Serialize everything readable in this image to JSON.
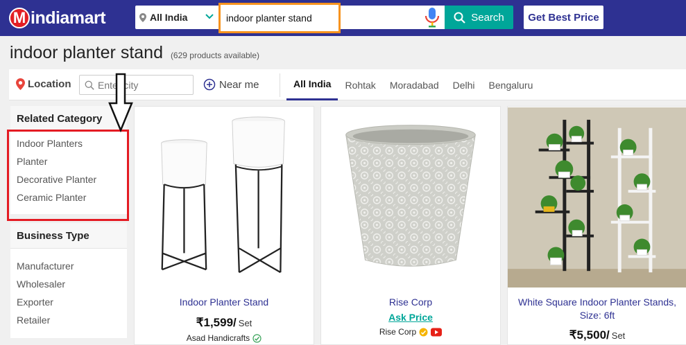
{
  "header": {
    "logo_letter": "M",
    "logo_text": "indiamart",
    "location_select": "All India",
    "search_value": "indoor planter stand",
    "search_button": "Search",
    "best_price_button": "Get Best Price"
  },
  "page": {
    "title": "indoor planter stand",
    "count": "(629 products available)"
  },
  "filters": {
    "location_label": "Location",
    "city_placeholder": "Enter city",
    "near_me": "Near me",
    "cities": [
      {
        "label": "All India",
        "active": true
      },
      {
        "label": "Rohtak",
        "active": false
      },
      {
        "label": "Moradabad",
        "active": false
      },
      {
        "label": "Delhi",
        "active": false
      },
      {
        "label": "Bengaluru",
        "active": false
      }
    ]
  },
  "sidebar": {
    "related_category": {
      "title": "Related Category",
      "items": [
        "Indoor Planters",
        "Planter",
        "Decorative Planter",
        "Ceramic Planter"
      ]
    },
    "business_type": {
      "title": "Business Type",
      "items": [
        "Manufacturer",
        "Wholesaler",
        "Exporter",
        "Retailer"
      ]
    }
  },
  "products": [
    {
      "name": "Indoor Planter Stand",
      "price": "₹1,599/",
      "unit": "Set",
      "seller": "Asad Handicrafts"
    },
    {
      "name": "Rise Corp",
      "ask_price": "Ask Price",
      "seller": "Rise Corp"
    },
    {
      "name": "White Square Indoor Planter Stands, Size: 6ft",
      "price": "₹5,500/",
      "unit": "Set"
    }
  ],
  "colors": {
    "brand": "#2e3192",
    "accent": "#00a699",
    "highlight_orange": "#f7931e",
    "annotation_red": "#e41b23"
  },
  "icons": [
    "location-pin-icon",
    "chevron-down-icon",
    "mic-icon",
    "search-icon",
    "near-me-icon",
    "verified-icon",
    "youtube-icon",
    "down-arrow-annotation"
  ]
}
